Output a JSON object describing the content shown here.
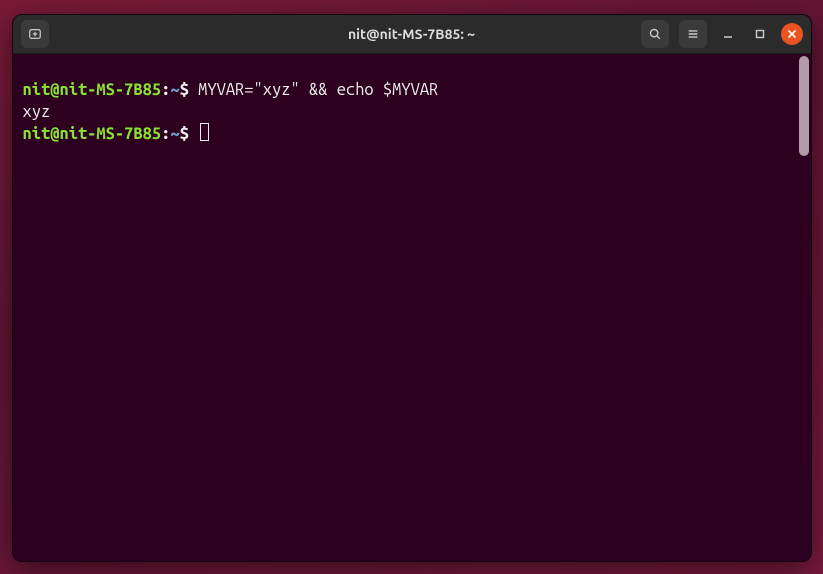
{
  "window": {
    "title": "nit@nit-MS-7B85: ~"
  },
  "prompt": {
    "user_host": "nit@nit-MS-7B85",
    "sep": ":",
    "path": "~",
    "symbol": "$"
  },
  "history": {
    "line1_cmd": "MYVAR=\"xyz\" && echo $MYVAR",
    "line2_out": "xyz"
  },
  "icons": {
    "new_tab": "new-tab-icon",
    "search": "search-icon",
    "menu": "hamburger-icon",
    "minimize": "minimize-icon",
    "maximize": "maximize-icon",
    "close": "close-icon"
  }
}
